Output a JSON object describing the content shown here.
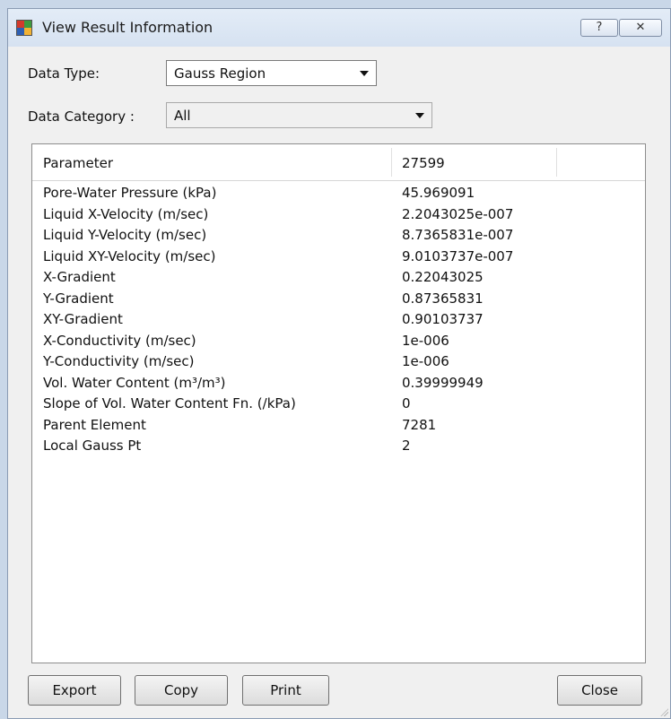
{
  "window": {
    "title": "View Result Information",
    "help_label": "?",
    "close_label": "✕"
  },
  "form": {
    "data_type_label": "Data Type:",
    "data_type_value": "Gauss Region",
    "data_category_label": "Data Category :",
    "data_category_value": "All"
  },
  "table": {
    "headers": [
      "Parameter",
      "27599",
      ""
    ],
    "rows": [
      {
        "param": "Pore-Water Pressure (kPa)",
        "value": "45.969091"
      },
      {
        "param": "Liquid X-Velocity (m/sec)",
        "value": "2.2043025e-007"
      },
      {
        "param": "Liquid Y-Velocity (m/sec)",
        "value": "8.7365831e-007"
      },
      {
        "param": "Liquid XY-Velocity (m/sec)",
        "value": "9.0103737e-007"
      },
      {
        "param": "X-Gradient",
        "value": "0.22043025"
      },
      {
        "param": "Y-Gradient",
        "value": "0.87365831"
      },
      {
        "param": "XY-Gradient",
        "value": "0.90103737"
      },
      {
        "param": "X-Conductivity (m/sec)",
        "value": "1e-006"
      },
      {
        "param": "Y-Conductivity (m/sec)",
        "value": "1e-006"
      },
      {
        "param": "Vol. Water Content (m³/m³)",
        "value": "0.39999949"
      },
      {
        "param": "Slope of Vol. Water Content Fn. (/kPa)",
        "value": "0"
      },
      {
        "param": "Parent Element",
        "value": "7281"
      },
      {
        "param": "Local Gauss Pt",
        "value": "2"
      }
    ]
  },
  "buttons": {
    "export": "Export",
    "copy": "Copy",
    "print": "Print",
    "close": "Close"
  },
  "icons": {
    "app": "app-grid-icon",
    "dropdown": "chevron-down-icon",
    "resize": "resize-grip-icon"
  },
  "colors": {
    "window_bg": "#f0f0f0",
    "titlebar": "#dae5f2",
    "icon_red": "#d33a2c",
    "icon_green": "#3e9b3e",
    "icon_blue": "#2d5fb3"
  }
}
